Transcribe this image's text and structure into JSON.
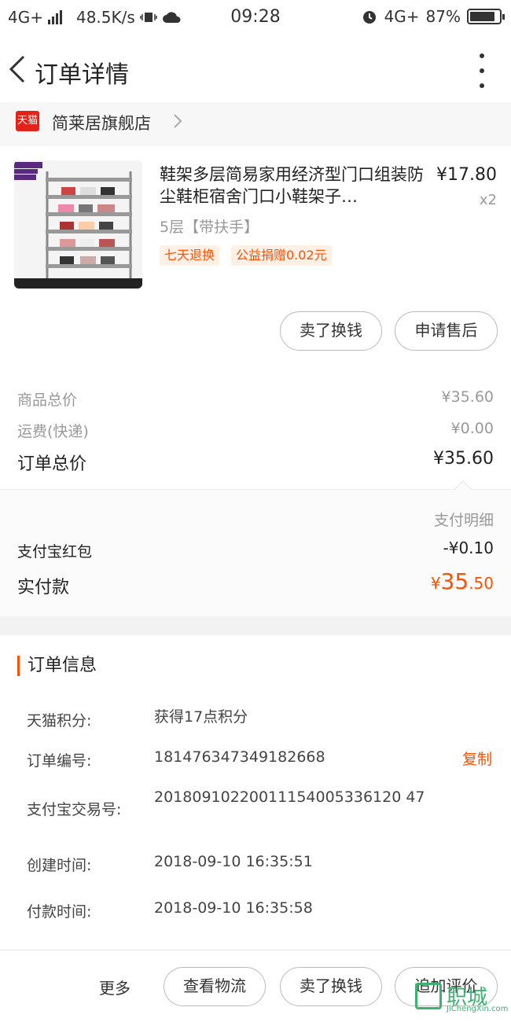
{
  "status_bar": {
    "network": "4G+",
    "speed": "48.5K/s",
    "time": "09:28",
    "network_right": "4G+",
    "battery_percent": "87%",
    "battery_level": 0.87
  },
  "nav": {
    "title": "订单详情"
  },
  "store": {
    "logo_text": "天猫",
    "name": "简莱居旗舰店"
  },
  "product": {
    "title": "鞋架多层简易家用经济型门口组装防尘鞋柜宿舍门口小鞋架子…",
    "price": "¥17.80",
    "quantity": "x2",
    "spec": "5层【带扶手】",
    "tags": [
      "七天退换",
      "公益捐赠0.02元"
    ],
    "buttons": {
      "sell": "卖了换钱",
      "after_sale": "申请售后"
    }
  },
  "summary": {
    "goods_total_label": "商品总价",
    "goods_total_value": "¥35.60",
    "shipping_label": "运费(快递)",
    "shipping_value": "¥0.00",
    "order_total_label": "订单总价",
    "order_total_value": "¥35.60"
  },
  "payment": {
    "detail_link": "支付明细",
    "redpacket_label": "支付宝红包",
    "redpacket_value": "-¥0.10",
    "paid_label": "实付款",
    "paid_currency": "¥",
    "paid_int": "35",
    "paid_dec": ".50"
  },
  "order_info": {
    "title": "订单信息",
    "points_label": "天猫积分:",
    "points_value": "获得17点积分",
    "order_no_label": "订单编号:",
    "order_no_value": "181476347349182668",
    "copy_label": "复制",
    "alipay_no_label": "支付宝交易号:",
    "alipay_no_value": "20180910220011154005336120 47",
    "created_label": "创建时间:",
    "created_value": "2018-09-10 16:35:51",
    "paid_time_label": "付款时间:",
    "paid_time_value": "2018-09-10 16:35:58"
  },
  "bottom_bar": {
    "more": "更多",
    "logistics": "查看物流",
    "sell": "卖了换钱",
    "review": "追加评价"
  },
  "watermark": {
    "text": "职城",
    "sub": "JiChengXin.com"
  }
}
